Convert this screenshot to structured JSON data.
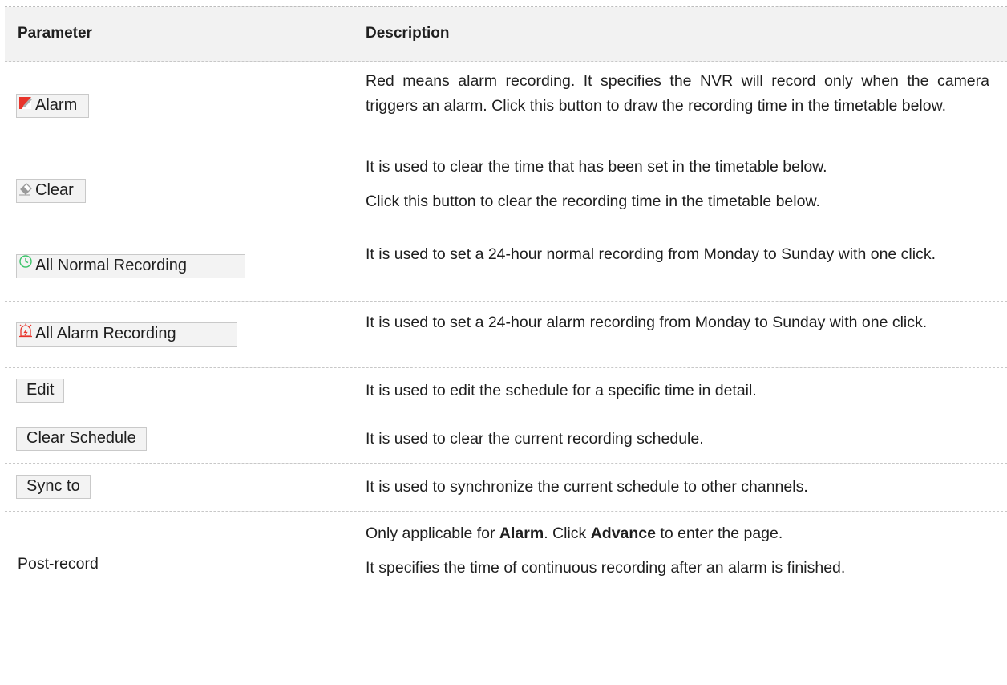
{
  "header": {
    "param": "Parameter",
    "desc": "Description"
  },
  "rows": [
    {
      "label": "Alarm",
      "icon": "alarm-pen-icon",
      "desc": "Red means alarm recording. It specifies the NVR will record only when the camera triggers an alarm. Click this button to draw the recording time in the timetable below."
    },
    {
      "label": "Clear",
      "icon": "eraser-icon",
      "desc1": "It is used to clear the time that has been set in the timetable below.",
      "desc2": "Click this button to clear the recording time in the timetable below."
    },
    {
      "label": "All Normal Recording",
      "icon": "clock-icon",
      "desc": "It is used to set a 24-hour normal recording from Monday to Sunday with one click."
    },
    {
      "label": "All Alarm Recording",
      "icon": "alarm-bell-icon",
      "desc": "It is used to set a 24-hour alarm recording from Monday to Sunday with one click."
    },
    {
      "label": "Edit",
      "desc": "It is used to edit the schedule for a specific time in detail."
    },
    {
      "label": "Clear Schedule",
      "desc": "It is used to clear the current recording schedule."
    },
    {
      "label": "Sync to",
      "desc": "It is used to synchronize the current schedule to other channels."
    },
    {
      "label": "Post-record",
      "desc1_a": "Only applicable for ",
      "desc1_b": "Alarm",
      "desc1_c": ". Click ",
      "desc1_d": "Advance",
      "desc1_e": " to enter the page.",
      "desc2": "It specifies the time of continuous recording after an alarm is finished."
    }
  ],
  "colors": {
    "alarm_red": "#e8342b",
    "clock_green": "#3cc46a",
    "eraser_gray": "#9a9a9a"
  }
}
